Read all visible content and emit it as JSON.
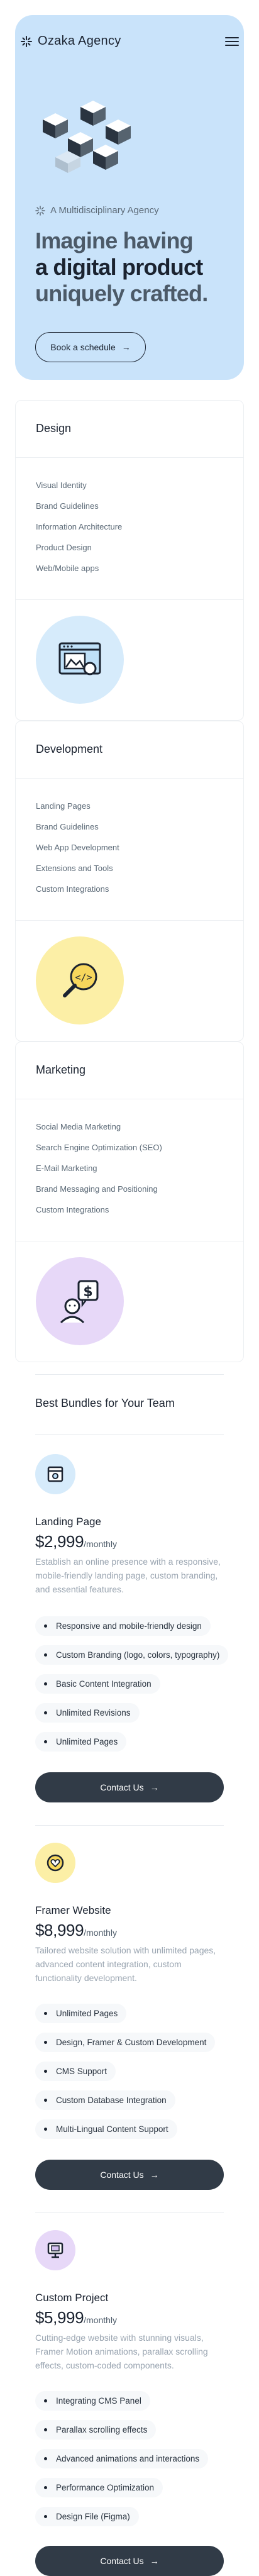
{
  "brand": {
    "name": "Ozaka Agency"
  },
  "hero": {
    "tagline": "A Multidisciplinary Agency",
    "headline_1": "Imagine having",
    "headline_2": "a digital product",
    "headline_3": "uniquely crafted.",
    "cta_label": "Book a schedule"
  },
  "services": [
    {
      "title": "Design",
      "items": [
        "Visual Identity",
        "Brand Guidelines",
        "Information Architecture",
        "Product Design",
        "Web/Mobile apps"
      ],
      "illustration": "browser-image-icon",
      "color": "#d6ebfb"
    },
    {
      "title": "Development",
      "items": [
        "Landing Pages",
        "Brand Guidelines",
        "Web App Development",
        "Extensions and Tools",
        "Custom Integrations"
      ],
      "illustration": "code-magnifier-icon",
      "color": "#fcefa6"
    },
    {
      "title": "Marketing",
      "items": [
        "Social Media Marketing",
        "Search Engine Optimization (SEO)",
        "E-Mail Marketing",
        "Brand Messaging and Positioning",
        "Custom Integrations"
      ],
      "illustration": "person-dollar-icon",
      "color": "#e7d8f8"
    }
  ],
  "bundles": {
    "title": "Best Bundles for Your Team",
    "plans": [
      {
        "name": "Landing Page",
        "price": "$2,999",
        "period": "/monthly",
        "description": "Establish an online presence with a responsive, mobile-friendly landing page, custom branding, and essential features.",
        "features": [
          "Responsive and mobile-friendly design",
          "Custom Branding (logo, colors, typography)",
          "Basic Content Integration",
          "Unlimited Revisions",
          "Unlimited Pages"
        ],
        "cta": "Contact Us",
        "icon": "layout-icon",
        "color": "#d6ebfb"
      },
      {
        "name": "Framer Website",
        "price": "$8,999",
        "period": "/monthly",
        "description": "Tailored website solution with unlimited pages, advanced content integration, custom functionality development.",
        "features": [
          "Unlimited Pages",
          "Design, Framer & Custom Development",
          "CMS Support",
          "Custom Database Integration",
          "Multi-Lingual Content Support"
        ],
        "cta": "Contact Us",
        "icon": "heart-badge-icon",
        "color": "#fcefa6"
      },
      {
        "name": "Custom Project",
        "price": "$5,999",
        "period": "/monthly",
        "description": "Cutting-edge website with stunning visuals, Framer Motion animations, parallax scrolling effects, custom-coded components.",
        "features": [
          "Integrating CMS Panel",
          "Parallax scrolling effects",
          "Advanced animations and interactions",
          "Performance Optimization",
          "Design File (Figma)"
        ],
        "cta": "Contact Us",
        "icon": "desktop-icon",
        "color": "#e7d8f8"
      }
    ]
  }
}
